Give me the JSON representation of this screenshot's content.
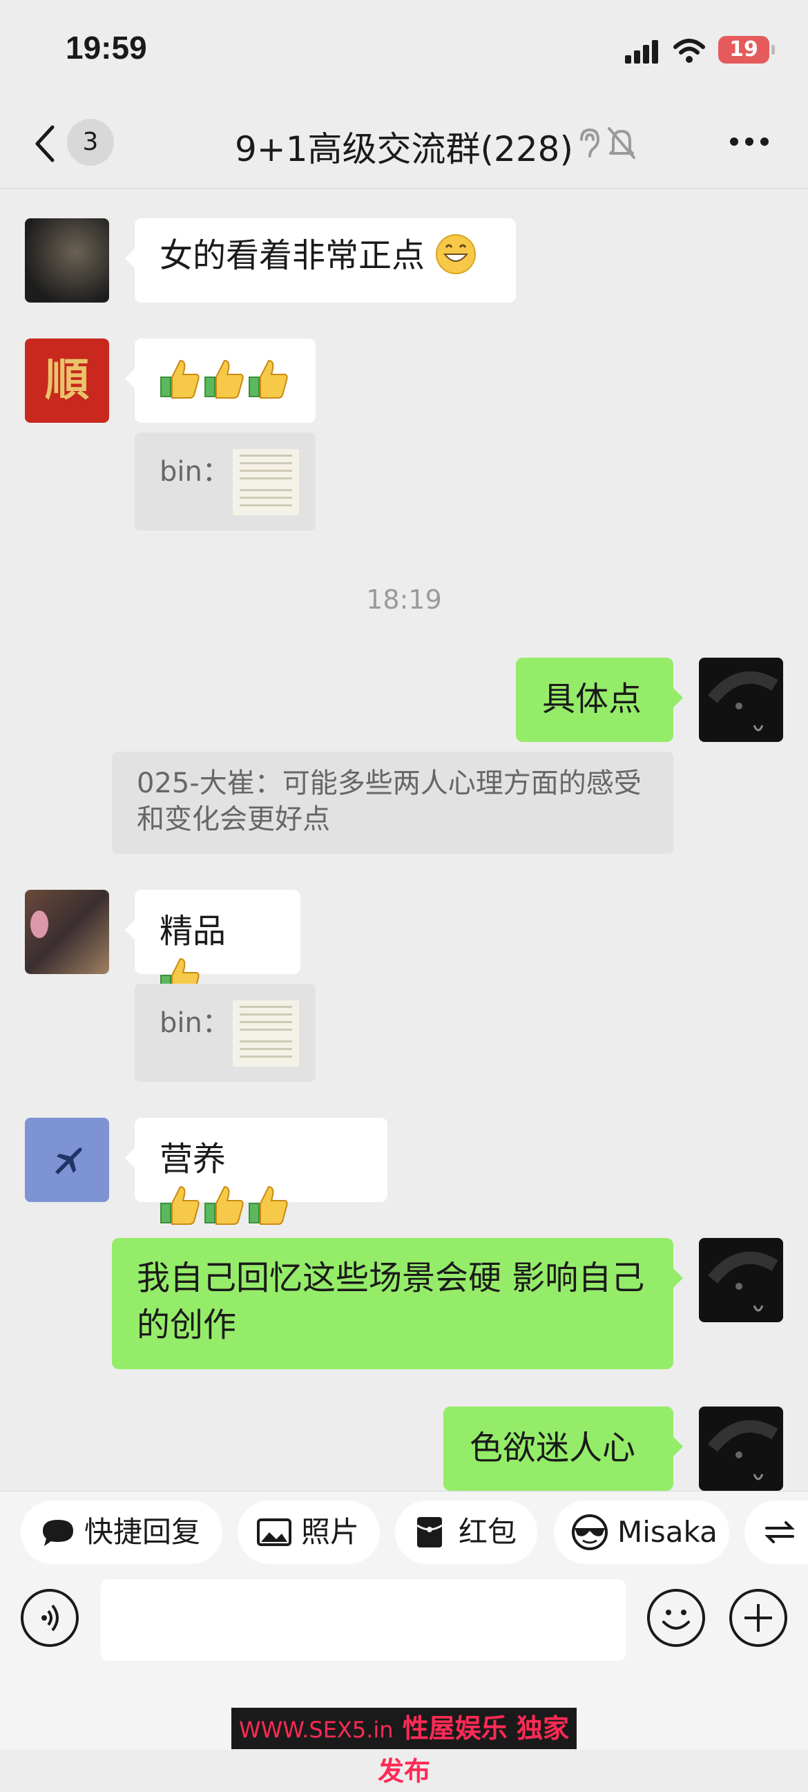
{
  "status_bar": {
    "time": "19:59",
    "battery": "19"
  },
  "nav": {
    "back_count": "3",
    "title": "9+1高级交流群(228)"
  },
  "messages": {
    "m1": "女的看着非常正点",
    "m2_quote_sender": "bin：",
    "timestamp": "18:19",
    "m3": "具体点",
    "m3_quote": "025-大崔：可能多些两人心理方面的感受和变化会更好点",
    "m4": "精品",
    "m4_quote_sender": "bin：",
    "m5": "营养",
    "m6": "我自己回忆这些场景会硬 影响自己的创作",
    "m7": "色欲迷人心"
  },
  "quick_actions": {
    "quick_reply": "快捷回复",
    "photo": "照片",
    "red_packet": "红包",
    "misaka": "Misaka"
  },
  "watermark": {
    "site": "WWW.SEX5.in",
    "text": "性屋娱乐 独家发布"
  },
  "colors": {
    "sent_bubble": "#95ec69",
    "received_bubble": "#ffffff",
    "background": "#ededed"
  },
  "icons": [
    "back-chevron-icon",
    "ear-icon",
    "mute-bell-icon",
    "more-icon",
    "thumbs-up-icon",
    "grin-emoji-icon",
    "chat-bubble-icon",
    "image-icon",
    "red-packet-icon",
    "sunglasses-icon",
    "switch-icon",
    "voice-icon",
    "emoji-icon",
    "plus-icon"
  ]
}
